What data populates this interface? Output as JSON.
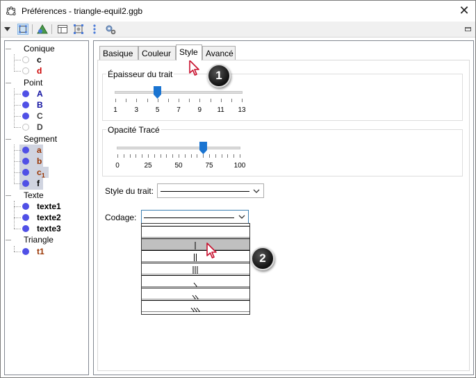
{
  "window": {
    "title": "Préférences - triangle-equil2.ggb"
  },
  "toolbar": {
    "icons": [
      "menu-arrow-icon",
      "graphics-icon",
      "algebra-triangle-icon",
      "layout-icon",
      "defaults-icon",
      "more-icon",
      "settings-gear-icon",
      "restore-icon"
    ]
  },
  "tree": {
    "groups": [
      {
        "label": "Conique",
        "items": [
          {
            "label": "c",
            "color": "#000000",
            "filled": false
          },
          {
            "label": "d",
            "color": "#cc0000",
            "filled": false
          }
        ]
      },
      {
        "label": "Point",
        "items": [
          {
            "label": "A",
            "color": "#1010a0",
            "filled": true
          },
          {
            "label": "B",
            "color": "#1010a0",
            "filled": true
          },
          {
            "label": "C",
            "color": "#404040",
            "filled": true
          },
          {
            "label": "D",
            "color": "#404040",
            "filled": false
          }
        ]
      },
      {
        "label": "Segment",
        "items": [
          {
            "label": "a",
            "color": "#993300",
            "filled": true
          },
          {
            "label": "b",
            "color": "#993300",
            "filled": true
          },
          {
            "label": "c",
            "sub": "1",
            "color": "#993300",
            "filled": true
          },
          {
            "label": "f",
            "color": "#000000",
            "filled": true
          }
        ]
      },
      {
        "label": "Texte",
        "items": [
          {
            "label": "texte1",
            "color": "#000000",
            "filled": true
          },
          {
            "label": "texte2",
            "color": "#000000",
            "filled": true
          },
          {
            "label": "texte3",
            "color": "#000000",
            "filled": true
          }
        ]
      },
      {
        "label": "Triangle",
        "items": [
          {
            "label": "t1",
            "color": "#993300",
            "filled": true
          }
        ]
      }
    ]
  },
  "tabs": [
    "Basique",
    "Couleur",
    "Style",
    "Avancé"
  ],
  "active_tab": "Style",
  "thickness": {
    "title": "Épaisseur du trait",
    "value": 5,
    "min": 1,
    "max": 13,
    "tick_labels": [
      "1",
      "3",
      "5",
      "7",
      "9",
      "11",
      "13"
    ]
  },
  "opacity": {
    "title": "Opacité Tracé",
    "value": 70,
    "min": 0,
    "max": 100,
    "tick_labels": [
      "0",
      "25",
      "50",
      "75",
      "100"
    ]
  },
  "line_style": {
    "label": "Style du trait:",
    "selected": "solid"
  },
  "decoration": {
    "label": "Codage:",
    "selected": "none",
    "options": [
      "none",
      "one-tick",
      "two-ticks",
      "three-ticks",
      "one-arrow",
      "two-arrows",
      "three-arrows"
    ],
    "highlighted_index": 1
  },
  "callouts": [
    "1",
    "2"
  ],
  "colors": {
    "accent_blue": "#1a74d1",
    "dot_blue": "#5050e6",
    "selection_gray": "#c0c0c0"
  }
}
